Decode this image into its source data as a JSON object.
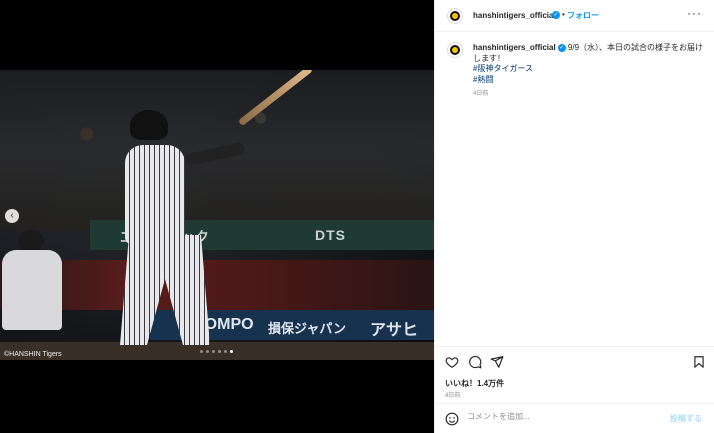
{
  "media": {
    "credit": "©HANSHIN Tigers",
    "carousel": {
      "total_dots": 6,
      "active_index": 5
    },
    "banners": {
      "top_left": "エイジェック",
      "top_right": "DTS",
      "bottom_left": "SOMPO",
      "bottom_mid": "損保ジャパン",
      "bottom_right": "アサヒ"
    }
  },
  "header": {
    "username": "hanshintigers_official",
    "separator": "•",
    "follow_label": "フォロー",
    "more_label": "···"
  },
  "caption": {
    "username": "hanshintigers_official",
    "text": "9/9（水）、本日の試合の様子をお届けします！",
    "hashtags": [
      "#阪神タイガース",
      "#熱闘"
    ],
    "age": "4日前"
  },
  "actions": {
    "likes": "いいね！1.4万件",
    "age": "4日前",
    "icons": [
      "heart-icon",
      "comment-icon",
      "share-icon",
      "bookmark-icon"
    ]
  },
  "comment": {
    "placeholder": "コメントを追加...",
    "post_label": "投稿する"
  },
  "colors": {
    "accent": "#0095f6",
    "hashtag": "#00376b",
    "muted": "#8e8e8e"
  }
}
